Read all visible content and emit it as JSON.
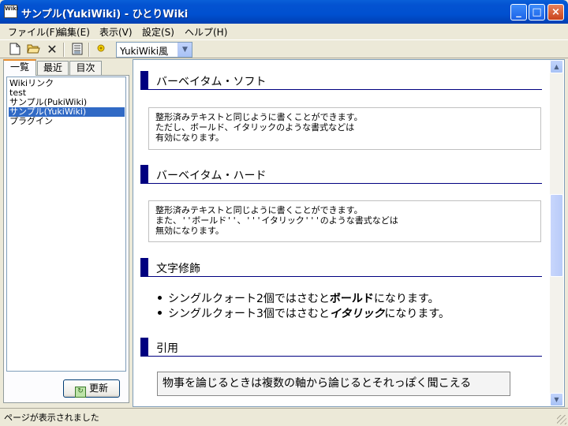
{
  "window": {
    "title": "サンプル(YukiWiki) - ひとりWiki",
    "icon_label": "Wiki",
    "controls": {
      "minimize": "_",
      "maximize": "□",
      "close": "×"
    }
  },
  "menu": [
    "ファイル(F)",
    "編集(E)",
    "表示(V)",
    "設定(S)",
    "ヘルプ(H)"
  ],
  "toolbar": {
    "buttons": [
      "new-file-icon",
      "open-folder-icon",
      "delete-icon",
      "save-doc-icon",
      "settings-sun-icon"
    ],
    "style_select": {
      "value": "YukiWiki風"
    }
  },
  "sidebar": {
    "tabs": [
      "一覧",
      "最近",
      "目次"
    ],
    "items": [
      "Wikiリンク",
      "test",
      "サンプル(PukiWiki)",
      "サンプル(YukiWiki)",
      "プラグイン"
    ],
    "selected_index": 3,
    "refresh_label": "更新"
  },
  "content": {
    "sections": [
      {
        "heading": "バーベイタム・ソフト",
        "body": "整形済みテキストと同じように書くことができます。\nただし、ボールド、イタリックのような書式などは\n有効になります。"
      },
      {
        "heading": "バーベイタム・ハード",
        "body": "整形済みテキストと同じように書くことができます。\nまた、''ボールド''、'''イタリック'''のような書式などは\n無効になります。"
      },
      {
        "heading": "文字修飾"
      },
      {
        "heading": "引用"
      }
    ],
    "bullets": [
      {
        "text_a": "シングルクォート2個ではさむと",
        "emph": "ボールド",
        "text_b": "になります。"
      },
      {
        "text_a": "シングルクォート3個ではさむと",
        "emph": "イタリック",
        "text_b": "になります。"
      }
    ],
    "quote": "物事を論じるときは複数の軸から論じるとそれっぽく聞こえる"
  },
  "status": {
    "text": "ページが表示されました"
  }
}
